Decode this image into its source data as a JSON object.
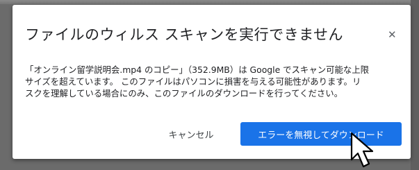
{
  "dialog": {
    "title": "ファイルのウィルス スキャンを実行できません",
    "close_icon": "close-icon",
    "message": "「オンライン留学説明会.mp4 のコピー」（352.9MB）は Google でスキャン可能な上限\nサイズを超えています。 このファイルはパソコンに損害を与える可能性があります。リ\nスクを理解している場合にのみ、このファイルのダウンロードを行ってください。",
    "cancel_label": "キャンセル",
    "download_label": "エラーを無視してダウンロード"
  },
  "colors": {
    "primary": "#1a73e8",
    "overlay": "#6b6b6b"
  }
}
